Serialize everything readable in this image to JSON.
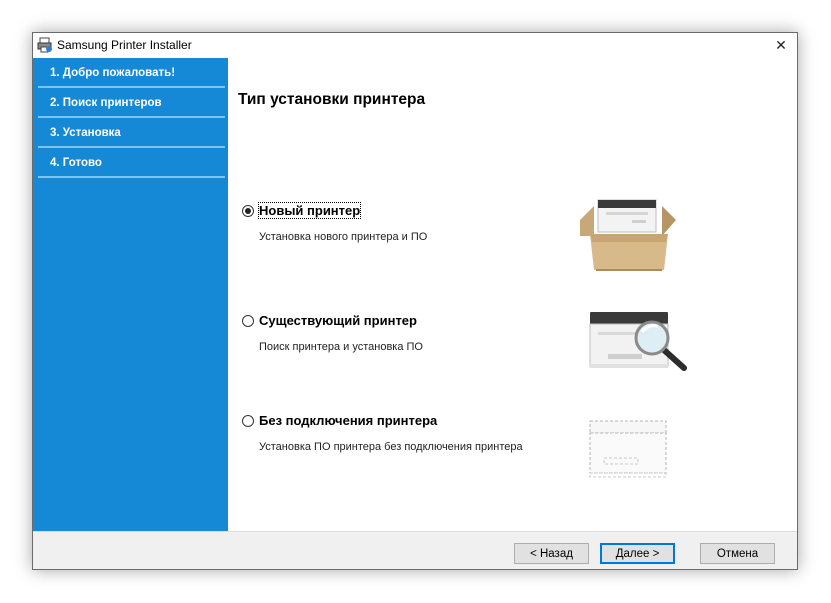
{
  "window": {
    "title": "Samsung Printer Installer",
    "close_glyph": "✕",
    "icon": "printer-setup-icon"
  },
  "sidebar": {
    "steps": [
      {
        "label": "1. Добро пожаловать!"
      },
      {
        "label": "2. Поиск принтеров"
      },
      {
        "label": "3. Установка"
      },
      {
        "label": "4. Готово"
      }
    ]
  },
  "main": {
    "heading": "Тип установки принтера",
    "options": [
      {
        "label": "Новый принтер",
        "description": "Установка нового принтера и ПО",
        "selected": true,
        "icon": "printer-in-box-icon"
      },
      {
        "label": "Существующий принтер",
        "description": "Поиск принтера и установка ПО",
        "selected": false,
        "icon": "printer-magnifier-icon"
      },
      {
        "label": "Без подключения принтера",
        "description": "Установка ПО принтера без подключения принтера",
        "selected": false,
        "icon": "printer-outline-icon"
      }
    ]
  },
  "footer": {
    "back_label": "< Назад",
    "next_label": "Далее >",
    "cancel_label": "Отмена"
  },
  "colors": {
    "sidebar": "#1589d6",
    "sidebar_divider": "#7cc3ee",
    "default_button_border": "#0078d7"
  }
}
